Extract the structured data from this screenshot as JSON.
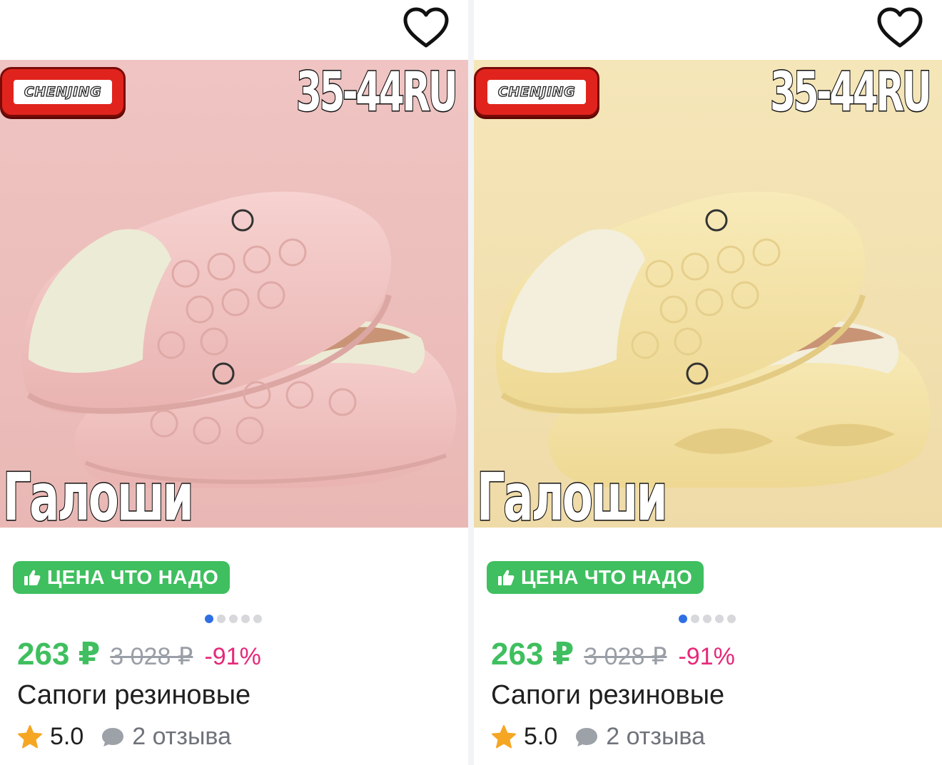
{
  "cards": [
    {
      "variant": "pink",
      "brand": "CHENJING",
      "size_text": "35-44RU",
      "overlay_text": "Галоши",
      "promo_label": "ЦЕНА ЧТО НАДО",
      "carousel": {
        "total": 5,
        "active": 1
      },
      "price": "263 ₽",
      "old_price": "3 028 ₽",
      "discount": "-91%",
      "title": "Сапоги резиновые",
      "rating": "5.0",
      "reviews": "2 отзыва",
      "colors": {
        "background": "#eebfbd",
        "shoe": "#f1c6c4",
        "lining": "#ecebd6"
      }
    },
    {
      "variant": "yellow",
      "brand": "CHENJING",
      "size_text": "35-44RU",
      "overlay_text": "Галоши",
      "promo_label": "ЦЕНА ЧТО НАДО",
      "carousel": {
        "total": 5,
        "active": 1
      },
      "price": "263 ₽",
      "old_price": "3 028 ₽",
      "discount": "-91%",
      "title": "Сапоги резиновые",
      "rating": "5.0",
      "reviews": "2 отзыва",
      "colors": {
        "background": "#f4e3b4",
        "shoe": "#f4e4a8",
        "lining": "#f2eedb"
      }
    }
  ],
  "icons": {
    "favorite": "heart-outline-icon",
    "promo": "thumbs-up-icon",
    "rating": "star-icon",
    "reviews": "chat-bubble-icon"
  },
  "theme": {
    "green": "#3fbf5f",
    "pink": "#e5297a",
    "blue": "#2f6fe4",
    "star": "#f5a623"
  }
}
